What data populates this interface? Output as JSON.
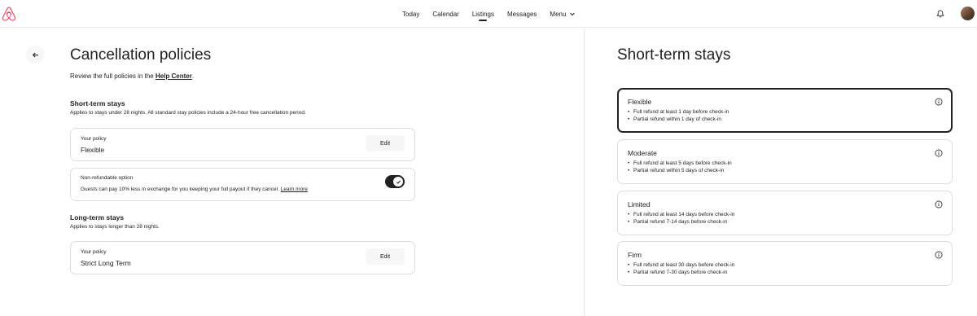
{
  "nav": {
    "items": [
      {
        "label": "Today",
        "active": false
      },
      {
        "label": "Calendar",
        "active": false
      },
      {
        "label": "Listings",
        "active": true
      },
      {
        "label": "Messages",
        "active": false
      }
    ],
    "menu_label": "Menu"
  },
  "left": {
    "title": "Cancellation policies",
    "review_prefix": "Review the full policies in the",
    "review_link": "Help Center",
    "review_suffix": ".",
    "short_term": {
      "title": "Short-term stays",
      "subtitle": "Applies to stays under 28 nights. All standard stay policies include a 24-hour free cancellation period.",
      "policy_label": "Your policy",
      "policy_value": "Flexible",
      "edit_label": "Edit"
    },
    "non_refundable": {
      "label": "Non-refundable option",
      "desc": "Guests can pay 10% less in exchange for you keeping your full payout if they cancel.",
      "link": "Learn more",
      "enabled": true
    },
    "long_term": {
      "title": "Long-term stays",
      "subtitle": "Applies to stays longer than 28 nights.",
      "policy_label": "Your policy",
      "policy_value": "Strict Long Term",
      "edit_label": "Edit"
    }
  },
  "right": {
    "title": "Short-term stays",
    "options": [
      {
        "name": "Flexible",
        "selected": true,
        "lines": [
          "Full refund at least 1 day before check-in",
          "Partial refund within 1 day of check-in"
        ]
      },
      {
        "name": "Moderate",
        "selected": false,
        "lines": [
          "Full refund at least 5 days before check-in",
          "Partial refund within 5 days of check-in"
        ]
      },
      {
        "name": "Limited",
        "selected": false,
        "lines": [
          "Full refund at least 14 days before check-in",
          "Partial refund 7-14 days before check-in"
        ]
      },
      {
        "name": "Firm",
        "selected": false,
        "lines": [
          "Full refund at least 30 days before check-in",
          "Partial refund 7-30 days before check-in"
        ]
      }
    ]
  },
  "colors": {
    "brand": "#FF385C",
    "text": "#222222",
    "border": "#DDDDDD"
  },
  "icons": [
    "airbnb-logo-icon",
    "chevron-down-icon",
    "bell-icon",
    "back-arrow-icon",
    "checkmark-icon",
    "info-icon"
  ]
}
